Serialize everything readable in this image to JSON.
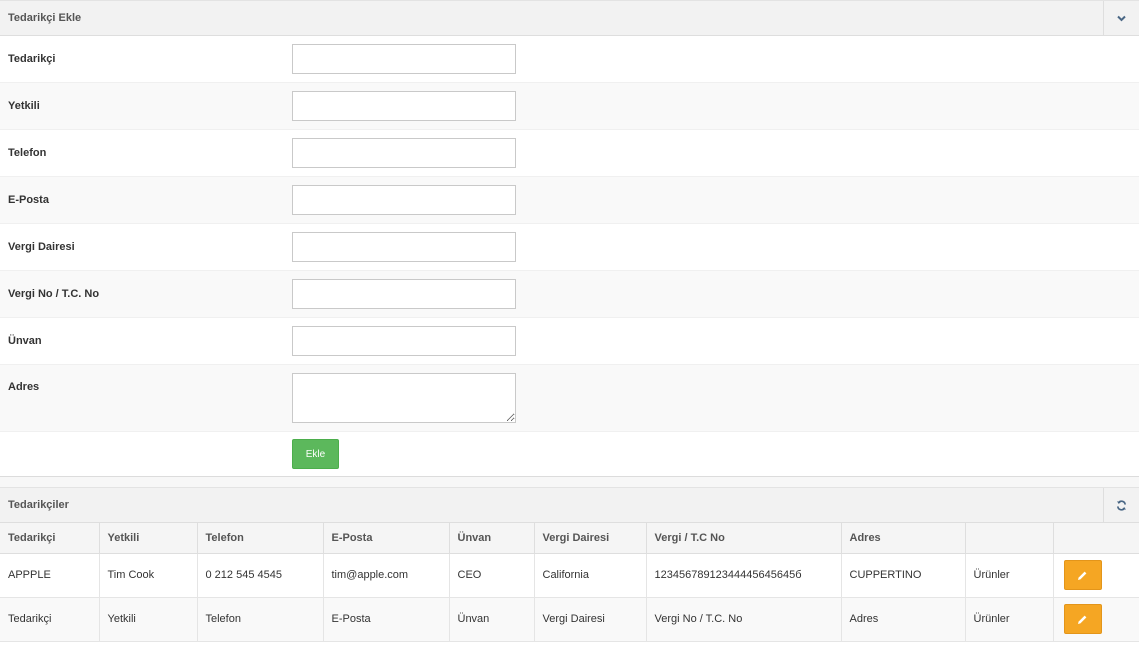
{
  "add_panel": {
    "title": "Tedarikçi Ekle",
    "collapse_icon": "chevron-down-icon",
    "fields": [
      {
        "label": "Tedarikçi",
        "value": ""
      },
      {
        "label": "Yetkili",
        "value": ""
      },
      {
        "label": "Telefon",
        "value": ""
      },
      {
        "label": "E-Posta",
        "value": ""
      },
      {
        "label": "Vergi Dairesi",
        "value": ""
      },
      {
        "label": "Vergi No / T.C. No",
        "value": ""
      },
      {
        "label": "Ünvan",
        "value": ""
      }
    ],
    "address": {
      "label": "Adres",
      "value": ""
    },
    "submit_label": "Ekle"
  },
  "list_panel": {
    "title": "Tedarikçiler",
    "refresh_icon": "refresh-icon",
    "columns": [
      "Tedarikçi",
      "Yetkili",
      "Telefon",
      "E-Posta",
      "Ünvan",
      "Vergi Dairesi",
      "Vergi / T.C No",
      "Adres",
      "",
      ""
    ],
    "rows": [
      {
        "tedarikci": "APPPLE",
        "yetkili": "Tim Cook",
        "telefon": "0 212 545 4545",
        "eposta": "tim@apple.com",
        "unvan": "CEO",
        "vergi_dairesi": "California",
        "vergi_no": "12345678912344445645645б",
        "adres": "CUPPERTINO",
        "link": "Ürünler",
        "edit_icon": "pencil-icon"
      },
      {
        "tedarikci": "Tedarikçi",
        "yetkili": "Yetkili",
        "telefon": "Telefon",
        "eposta": "E-Posta",
        "unvan": "Ünvan",
        "vergi_dairesi": "Vergi Dairesi",
        "vergi_no": "Vergi No / T.C. No",
        "adres": "Adres",
        "link": "Ürünler",
        "edit_icon": "pencil-icon"
      }
    ]
  },
  "colors": {
    "green": "#5cb85c",
    "orange": "#f5a623",
    "header_bg": "#f2f2f2"
  }
}
